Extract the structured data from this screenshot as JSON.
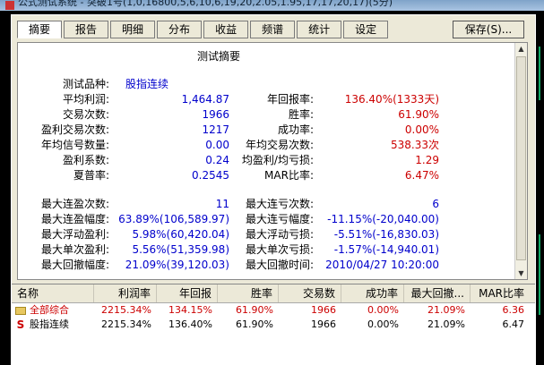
{
  "window_title": "公式测试系统 - 突破1号(1,0,16800,5,6,10,6,19,20,2.05,1.95,17,17,20,17)(5分)",
  "tabs": [
    {
      "label": "摘要",
      "active": true
    },
    {
      "label": "报告"
    },
    {
      "label": "明细"
    },
    {
      "label": "分布"
    },
    {
      "label": "收益"
    },
    {
      "label": "频谱"
    },
    {
      "label": "统计"
    },
    {
      "label": "设定"
    }
  ],
  "save_button": "保存(S)...",
  "summary": {
    "title": "测试摘要",
    "test_variety_label": "测试品种:",
    "test_variety_value": "股指连续",
    "avg_profit_label": "平均利润:",
    "avg_profit_value": "1,464.87",
    "annual_return_label": "年回报率:",
    "annual_return_value": "136.40%(1333天)",
    "trade_count_label": "交易次数:",
    "trade_count_value": "1966",
    "win_rate_label": "胜率:",
    "win_rate_value": "61.90%",
    "profit_trades_label": "盈利交易次数:",
    "profit_trades_value": "1217",
    "success_rate_label": "成功率:",
    "success_rate_value": "0.00%",
    "annual_signals_label": "年均信号数量:",
    "annual_signals_value": "0.00",
    "annual_trades_label": "年均交易次数:",
    "annual_trades_value": "538.33次",
    "profit_factor_label": "盈利系数:",
    "profit_factor_value": "0.24",
    "avg_win_loss_label": "均盈利/均亏损:",
    "avg_win_loss_value": "1.29",
    "sharpe_label": "夏普率:",
    "sharpe_value": "0.2545",
    "mar_label": "MAR比率:",
    "mar_value": "6.47%",
    "max_consec_win_label": "最大连盈次数:",
    "max_consec_win_value": "11",
    "max_consec_loss_label": "最大连亏次数:",
    "max_consec_loss_value": "6",
    "max_consec_win_amt_label": "最大连盈幅度:",
    "max_consec_win_amt_value": "63.89%(106,589.97)",
    "max_consec_loss_amt_label": "最大连亏幅度:",
    "max_consec_loss_amt_value": "-11.15%(-20,040.00)",
    "max_float_profit_label": "最大浮动盈利:",
    "max_float_profit_value": "5.98%(60,420.04)",
    "max_float_loss_label": "最大浮动亏损:",
    "max_float_loss_value": "-5.51%(-16,830.03)",
    "max_single_profit_label": "最大单次盈利:",
    "max_single_profit_value": "5.56%(51,359.98)",
    "max_single_loss_label": "最大单次亏损:",
    "max_single_loss_value": "-1.57%(-14,940.01)",
    "max_drawdown_label": "最大回撤幅度:",
    "max_drawdown_value": "21.09%(39,120.03)",
    "max_drawdown_time_label": "最大回撤时间:",
    "max_drawdown_time_value": "2010/04/27 10:20:00"
  },
  "table": {
    "headers": [
      "名称",
      "利润率",
      "年回报",
      "胜率",
      "交易数",
      "成功率",
      "最大回撤...",
      "MAR比率"
    ],
    "rows": [
      {
        "icon": "folder-icon",
        "name": "全部综合",
        "profit": "2215.34%",
        "annual": "134.15%",
        "win": "61.90%",
        "trades": "1966",
        "success": "0.00%",
        "drawdown": "21.09%",
        "mar": "6.36"
      },
      {
        "icon": "s-icon",
        "icon_text": "S",
        "name": "股指连续",
        "profit": "2215.34%",
        "annual": "136.40%",
        "win": "61.90%",
        "trades": "1966",
        "success": "0.00%",
        "drawdown": "21.09%",
        "mar": "6.47"
      }
    ]
  }
}
